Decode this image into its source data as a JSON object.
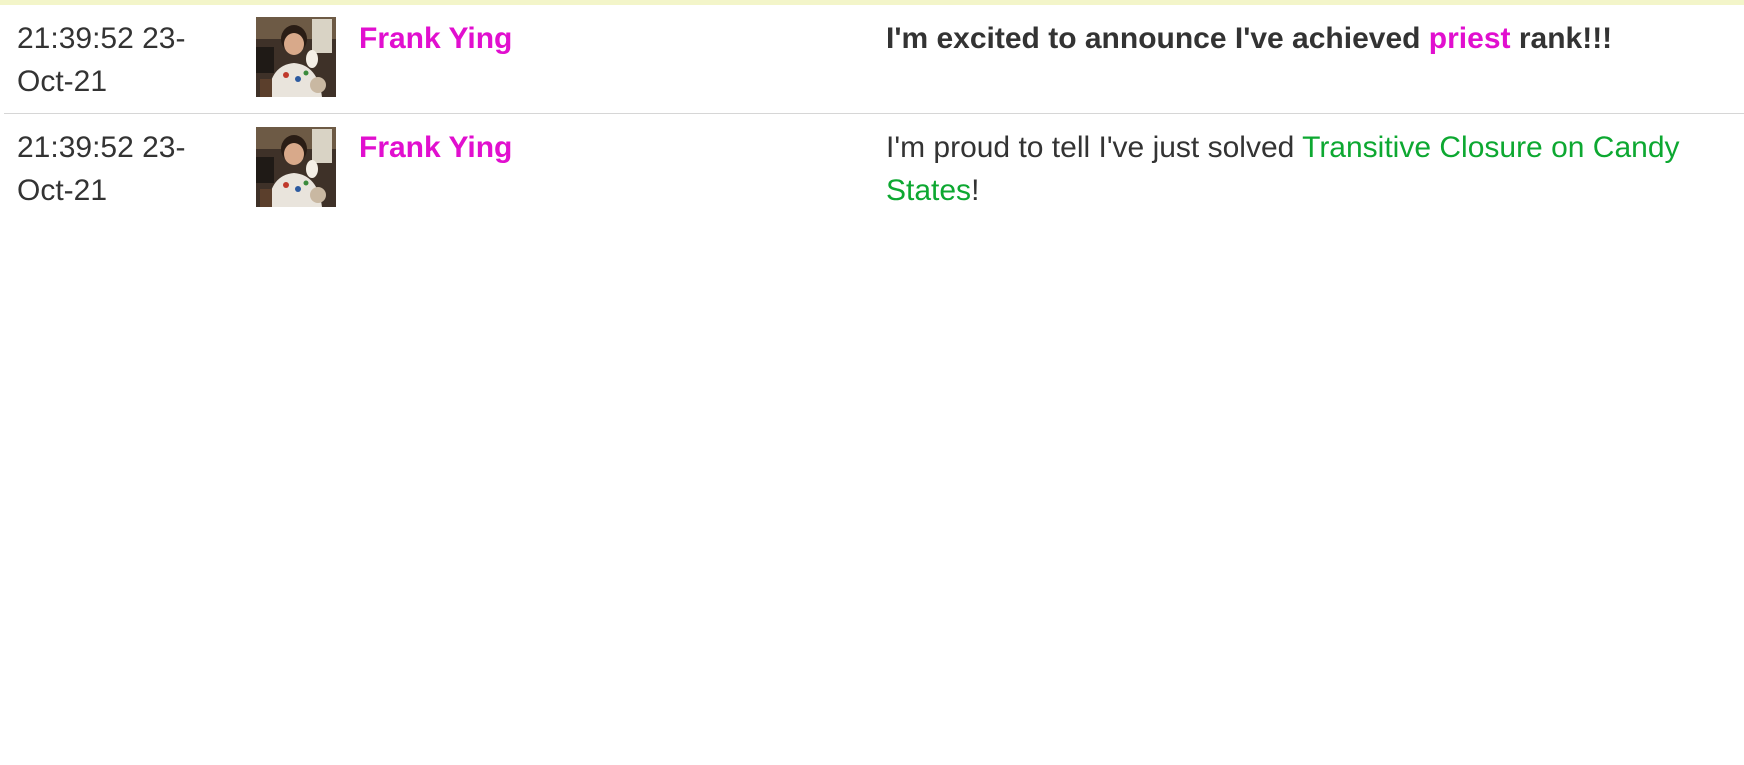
{
  "feed": {
    "items": [
      {
        "time": "21:39:52 23-Oct-21",
        "avatar_alt": "Frank Ying",
        "user": "Frank Ying",
        "message": {
          "prefix": "I'm excited to announce I've achieved ",
          "link": "priest",
          "suffix": " rank!!!"
        }
      },
      {
        "time": "21:39:52 23-Oct-21",
        "avatar_alt": "Frank Ying",
        "user": "Frank Ying",
        "message": {
          "prefix": "I'm proud to tell I've just solved ",
          "link": "Transitive Closure on Candy States",
          "suffix": "!"
        }
      }
    ]
  },
  "colors": {
    "username": "#e10fcf",
    "rank_link": "#e10fcf",
    "problem_link": "#0da831",
    "text": "#333333",
    "divider": "#d6d6d6",
    "top_strip": "#f3f5c9"
  }
}
